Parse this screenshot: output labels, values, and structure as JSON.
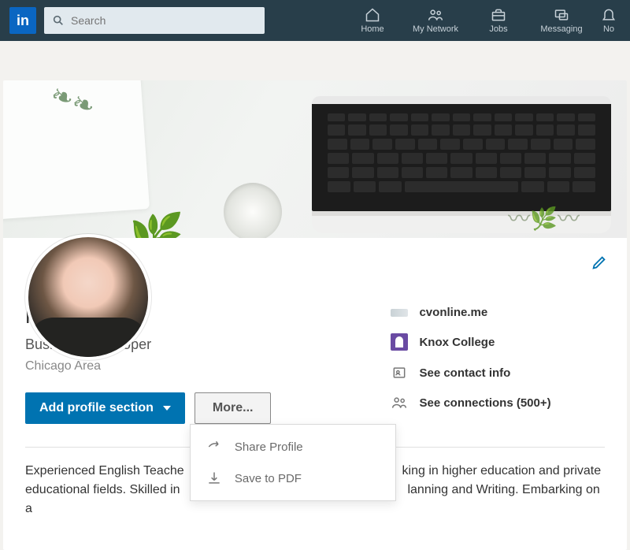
{
  "nav": {
    "search_placeholder": "Search",
    "items": [
      {
        "label": "Home"
      },
      {
        "label": "My Network"
      },
      {
        "label": "Jobs"
      },
      {
        "label": "Messaging"
      },
      {
        "label": "No"
      }
    ]
  },
  "profile": {
    "name": "Kaitlin",
    "title": "Business Developer",
    "location": "Chicago Area",
    "add_section_label": "Add profile section",
    "more_label": "More...",
    "dropdown": {
      "share": "Share Profile",
      "save_pdf": "Save to PDF"
    },
    "bio_line1": "Experienced English Teache",
    "bio_line1b": "king in higher education and private",
    "bio_line2": "educational fields. Skilled in",
    "bio_line2b": "lanning and Writing. Embarking on a"
  },
  "side": {
    "website": "cvonline.me",
    "school": "Knox College",
    "contact": "See contact info",
    "connections": "See connections (500+)"
  },
  "logo": "in"
}
